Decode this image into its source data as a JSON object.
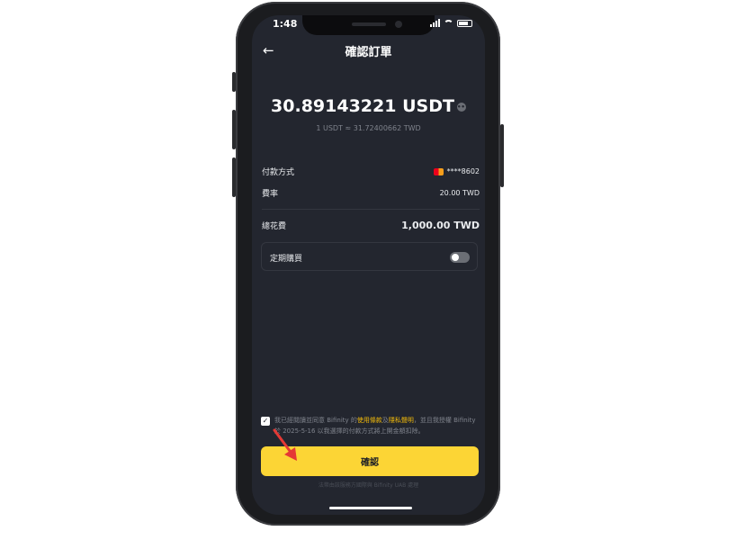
{
  "status": {
    "time": "1:48"
  },
  "header": {
    "title": "確認訂單",
    "back_icon": "arrow-left-icon"
  },
  "order": {
    "amount": "30.89143221 USDT",
    "rate": "1 USDT ≈ 31.72400662 TWD",
    "payment_label": "付款方式",
    "payment_value": "****8602",
    "fee_label": "費率",
    "fee_value": "20.00 TWD",
    "total_label": "總花費",
    "total_value": "1,000.00 TWD",
    "recurring_label": "定期購買",
    "recurring_on": false
  },
  "agreement": {
    "checked": true,
    "text_before": "我已經閱讀並同意 Bifinity 的",
    "terms_link": "使用條款",
    "and": "及",
    "privacy_link": "隱私聲明",
    "text_after": "，並且我授權 Bifinity 於 2025-5-16 以我選擇的付款方式將上開金額扣除。"
  },
  "confirm_label": "確認",
  "footer": "法幣由該服務方國際與 Bifinity UAB 處理",
  "colors": {
    "accent": "#fcd535",
    "background": "#23262f",
    "link": "#f0b90b"
  }
}
